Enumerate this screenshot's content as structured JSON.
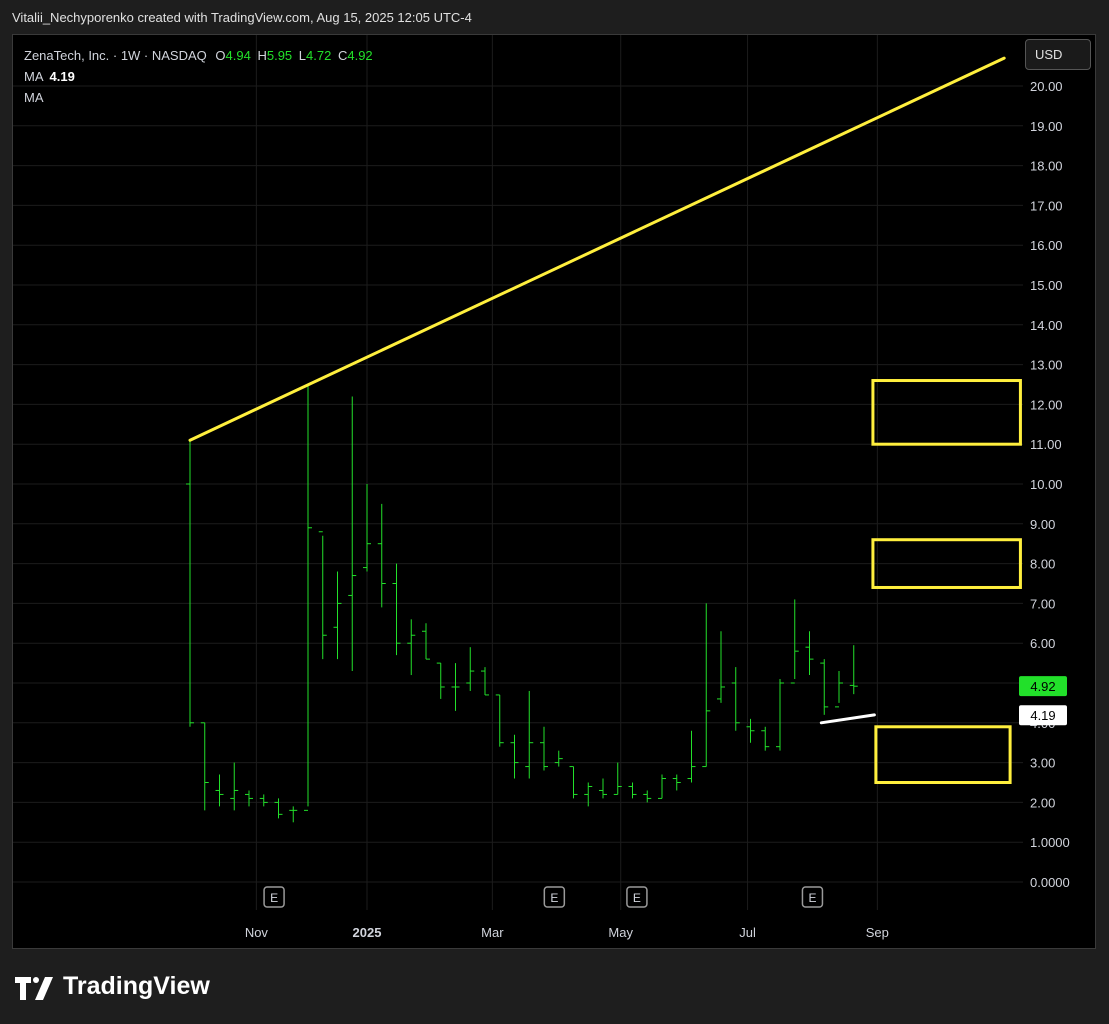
{
  "header": {
    "credit": "Vitalii_Nechyporenko created with TradingView.com, Aug 15, 2025 12:05 UTC-4"
  },
  "legend": {
    "symbol": "ZenaTech, Inc. · 1W · NASDAQ",
    "open_key": "O",
    "open": "4.94",
    "high_key": "H",
    "high": "5.95",
    "low_key": "L",
    "low": "4.72",
    "close_key": "C",
    "close": "4.92",
    "ma1_label": "MA",
    "ma1_value": "4.19",
    "ma2_label": "MA"
  },
  "currency_button": "USD",
  "footer": {
    "brand": "TradingView"
  },
  "colors": {
    "bar": "#22e02a",
    "trendline": "#ffef3d",
    "ma": "#ffffff",
    "last_price_bg": "#22e02a",
    "grid": "#1c1c1c"
  },
  "chart_data": {
    "type": "ohlc",
    "y_ticks": [
      "20.00",
      "19.00",
      "18.00",
      "17.00",
      "16.00",
      "15.00",
      "14.00",
      "13.00",
      "12.00",
      "11.00",
      "10.00",
      "9.00",
      "8.00",
      "7.00",
      "6.00",
      "5.00",
      "4.00",
      "3.00",
      "2.00",
      "1.0000",
      "0.0000"
    ],
    "ylim": [
      0,
      20
    ],
    "x_ticks": [
      {
        "label": "Nov",
        "week": 4.5,
        "bold": false
      },
      {
        "label": "2025",
        "week": 12,
        "bold": true
      },
      {
        "label": "Mar",
        "week": 20.5,
        "bold": false
      },
      {
        "label": "May",
        "week": 29.2,
        "bold": false
      },
      {
        "label": "Jul",
        "week": 37.8,
        "bold": false
      },
      {
        "label": "Sep",
        "week": 46.6,
        "bold": false
      }
    ],
    "earnings_markers": [
      {
        "label": "E",
        "week": 5.7
      },
      {
        "label": "E",
        "week": 24.7
      },
      {
        "label": "E",
        "week": 30.3
      },
      {
        "label": "E",
        "week": 42.2
      }
    ],
    "bars": [
      {
        "w": 0,
        "o": 10.0,
        "h": 11.1,
        "l": 3.9,
        "c": 4.0
      },
      {
        "w": 1,
        "o": 4.0,
        "h": 4.0,
        "l": 1.8,
        "c": 2.5
      },
      {
        "w": 2,
        "o": 2.3,
        "h": 2.7,
        "l": 1.9,
        "c": 2.2
      },
      {
        "w": 3,
        "o": 2.1,
        "h": 3.0,
        "l": 1.8,
        "c": 2.3
      },
      {
        "w": 4,
        "o": 2.2,
        "h": 2.3,
        "l": 1.9,
        "c": 2.1
      },
      {
        "w": 5,
        "o": 2.1,
        "h": 2.2,
        "l": 1.9,
        "c": 2.0
      },
      {
        "w": 6,
        "o": 2.0,
        "h": 2.1,
        "l": 1.6,
        "c": 1.7
      },
      {
        "w": 7,
        "o": 1.8,
        "h": 1.9,
        "l": 1.5,
        "c": 1.8
      },
      {
        "w": 8,
        "o": 1.8,
        "h": 12.5,
        "l": 1.9,
        "c": 8.9
      },
      {
        "w": 9,
        "o": 8.8,
        "h": 8.7,
        "l": 5.6,
        "c": 6.2
      },
      {
        "w": 10,
        "o": 6.4,
        "h": 7.8,
        "l": 5.6,
        "c": 7.0
      },
      {
        "w": 11,
        "o": 7.2,
        "h": 12.2,
        "l": 5.3,
        "c": 7.7
      },
      {
        "w": 12,
        "o": 7.9,
        "h": 10.0,
        "l": 7.8,
        "c": 8.5
      },
      {
        "w": 13,
        "o": 8.5,
        "h": 9.5,
        "l": 6.9,
        "c": 7.5
      },
      {
        "w": 14,
        "o": 7.5,
        "h": 8.0,
        "l": 5.7,
        "c": 6.0
      },
      {
        "w": 15,
        "o": 6.0,
        "h": 6.6,
        "l": 5.2,
        "c": 6.2
      },
      {
        "w": 16,
        "o": 6.3,
        "h": 6.5,
        "l": 5.6,
        "c": 5.6
      },
      {
        "w": 17,
        "o": 5.5,
        "h": 5.5,
        "l": 4.6,
        "c": 4.9
      },
      {
        "w": 18,
        "o": 4.9,
        "h": 5.5,
        "l": 4.3,
        "c": 4.9
      },
      {
        "w": 19,
        "o": 5.0,
        "h": 5.9,
        "l": 4.8,
        "c": 5.3
      },
      {
        "w": 20,
        "o": 5.3,
        "h": 5.4,
        "l": 4.7,
        "c": 4.7
      },
      {
        "w": 21,
        "o": 4.7,
        "h": 4.7,
        "l": 3.4,
        "c": 3.5
      },
      {
        "w": 22,
        "o": 3.5,
        "h": 3.7,
        "l": 2.6,
        "c": 3.0
      },
      {
        "w": 23,
        "o": 2.9,
        "h": 4.8,
        "l": 2.6,
        "c": 3.5
      },
      {
        "w": 24,
        "o": 3.5,
        "h": 3.9,
        "l": 2.8,
        "c": 2.9
      },
      {
        "w": 25,
        "o": 3.0,
        "h": 3.3,
        "l": 2.9,
        "c": 3.1
      },
      {
        "w": 26,
        "o": 2.9,
        "h": 2.9,
        "l": 2.1,
        "c": 2.2
      },
      {
        "w": 27,
        "o": 2.2,
        "h": 2.5,
        "l": 1.9,
        "c": 2.4
      },
      {
        "w": 28,
        "o": 2.3,
        "h": 2.6,
        "l": 2.1,
        "c": 2.2
      },
      {
        "w": 29,
        "o": 2.2,
        "h": 3.0,
        "l": 2.2,
        "c": 2.4
      },
      {
        "w": 30,
        "o": 2.4,
        "h": 2.5,
        "l": 2.1,
        "c": 2.2
      },
      {
        "w": 31,
        "o": 2.2,
        "h": 2.3,
        "l": 2.0,
        "c": 2.1
      },
      {
        "w": 32,
        "o": 2.1,
        "h": 2.7,
        "l": 2.1,
        "c": 2.6
      },
      {
        "w": 33,
        "o": 2.6,
        "h": 2.7,
        "l": 2.3,
        "c": 2.5
      },
      {
        "w": 34,
        "o": 2.6,
        "h": 3.8,
        "l": 2.5,
        "c": 2.9
      },
      {
        "w": 35,
        "o": 2.9,
        "h": 7.0,
        "l": 2.9,
        "c": 4.3
      },
      {
        "w": 36,
        "o": 4.6,
        "h": 6.3,
        "l": 4.5,
        "c": 4.9
      },
      {
        "w": 37,
        "o": 5.0,
        "h": 5.4,
        "l": 3.8,
        "c": 4.0
      },
      {
        "w": 38,
        "o": 3.9,
        "h": 4.1,
        "l": 3.5,
        "c": 3.8
      },
      {
        "w": 39,
        "o": 3.8,
        "h": 3.9,
        "l": 3.3,
        "c": 3.4
      },
      {
        "w": 40,
        "o": 3.4,
        "h": 5.1,
        "l": 3.3,
        "c": 5.0
      },
      {
        "w": 41,
        "o": 5.0,
        "h": 7.1,
        "l": 5.1,
        "c": 5.8
      },
      {
        "w": 42,
        "o": 5.9,
        "h": 6.3,
        "l": 5.2,
        "c": 5.6
      },
      {
        "w": 43,
        "o": 5.5,
        "h": 5.6,
        "l": 4.2,
        "c": 4.4
      },
      {
        "w": 44,
        "o": 4.4,
        "h": 5.3,
        "l": 4.5,
        "c": 5.0
      },
      {
        "w": 45,
        "o": 4.94,
        "h": 5.95,
        "l": 4.72,
        "c": 4.92
      }
    ],
    "trendline": {
      "from": {
        "week": 0,
        "price": 11.1
      },
      "to": {
        "week": 55.2,
        "price": 20.7
      }
    },
    "ma_segment": {
      "from": {
        "week": 42.8,
        "price": 4.0
      },
      "to": {
        "week": 46.4,
        "price": 4.2
      }
    },
    "last_price_label": "4.92",
    "ma_price_label": "4.19",
    "zones": [
      {
        "from_week": 46.3,
        "to_week": 56.3,
        "top": 12.6,
        "bottom": 11.0
      },
      {
        "from_week": 46.3,
        "to_week": 56.3,
        "top": 8.6,
        "bottom": 7.4
      },
      {
        "from_week": 46.5,
        "to_week": 55.6,
        "top": 3.9,
        "bottom": 2.5
      }
    ]
  }
}
